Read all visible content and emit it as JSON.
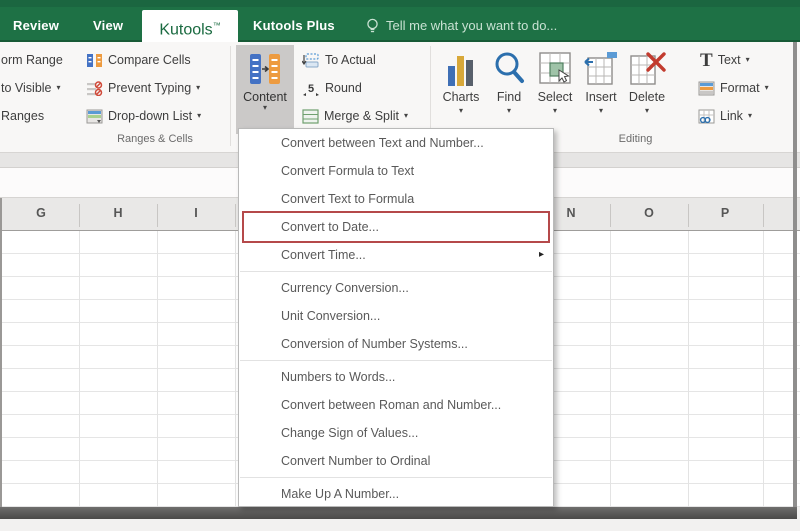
{
  "icons": {
    "chevron_down": "▾",
    "submenu_arrow": "▸"
  },
  "tabs": {
    "review": "Review",
    "view": "View",
    "kutools": "Kutools",
    "kutools_sup": "™",
    "kutools_plus": "Kutools Plus",
    "tell_me": "Tell me what you want to do..."
  },
  "ribbon": {
    "ranges_cells": {
      "row1": "orm Range",
      "row2": "to Visible",
      "row3": "Ranges",
      "compare_cells": "Compare Cells",
      "prevent_typing": "Prevent Typing",
      "dropdown_list": "Drop-down List",
      "label": "Ranges & Cells"
    },
    "content_group": {
      "content": "Content",
      "to_actual": "To Actual",
      "round": "Round",
      "merge_split": "Merge & Split"
    },
    "charts": "Charts",
    "editing": {
      "find": "Find",
      "select": "Select",
      "insert": "Insert",
      "delete": "Delete",
      "text": "Text",
      "format": "Format",
      "link": "Link",
      "label": "Editing"
    }
  },
  "menu": {
    "items": [
      {
        "label": "Convert between Text and Number..."
      },
      {
        "label": "Convert Formula to Text"
      },
      {
        "label": "Convert Text to Formula"
      },
      {
        "label": "Convert to Date...",
        "boxed": true
      },
      {
        "label": "Convert Time...",
        "submenu": true
      },
      {
        "label": "Currency Conversion..."
      },
      {
        "label": "Unit Conversion..."
      },
      {
        "label": "Conversion of Number Systems..."
      },
      {
        "label": "Numbers to Words..."
      },
      {
        "label": "Convert between Roman and Number..."
      },
      {
        "label": "Change Sign of Values..."
      },
      {
        "label": "Convert Number to Ordinal"
      },
      {
        "label": "Make Up A Number..."
      }
    ]
  },
  "sheet": {
    "cols_left": [
      "G",
      "H",
      "I"
    ],
    "cols_right": [
      "N",
      "O",
      "P"
    ]
  },
  "colors": {
    "excel_green": "#1e7145",
    "active_tab_text": "#1a6a40",
    "highlight_red": "#b5494a",
    "accent_blue": "#4472c4",
    "accent_orange": "#ed9b40"
  }
}
